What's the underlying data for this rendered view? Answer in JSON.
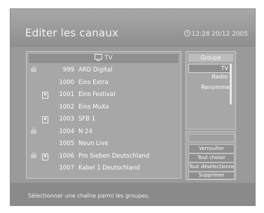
{
  "header": {
    "title": "Editer les canaux",
    "clock": "12:28 20/12 2005"
  },
  "channel_list": {
    "title": "TV",
    "rows": [
      {
        "locked": true,
        "favorite": false,
        "number": "999",
        "name": "ARD Digital"
      },
      {
        "locked": false,
        "favorite": false,
        "number": "1000",
        "name": "Eins Extra"
      },
      {
        "locked": false,
        "favorite": true,
        "number": "1001",
        "name": "Eins Festival"
      },
      {
        "locked": false,
        "favorite": false,
        "number": "1002",
        "name": "Eins MuXx"
      },
      {
        "locked": false,
        "favorite": true,
        "number": "1003",
        "name": "SFB 1"
      },
      {
        "locked": true,
        "favorite": false,
        "number": "1004",
        "name": "N 24"
      },
      {
        "locked": false,
        "favorite": false,
        "number": "1005",
        "name": "Neun Live"
      },
      {
        "locked": true,
        "favorite": true,
        "number": "1006",
        "name": "Pro Sieben Deutschland"
      },
      {
        "locked": false,
        "favorite": false,
        "number": "1007",
        "name": "Kabel 1 Deutschland"
      }
    ]
  },
  "group_panel": {
    "title": "Groupe",
    "items": [
      "TV",
      "Radio"
    ],
    "selected": "TV",
    "rename_label": "Renommer"
  },
  "actions": {
    "lock": "Verrouiller",
    "select_all": "Tout choisir",
    "deselect_all": "Tout désélectionner",
    "delete": "Supprimer"
  },
  "status_bar": {
    "message": "Sélectionner une chaîne parmi les groupes."
  },
  "colors": {
    "background": "#9a9a9a",
    "panel": "#a7a7a7",
    "highlight": "#8f8f8f",
    "text": "#ffffff"
  }
}
